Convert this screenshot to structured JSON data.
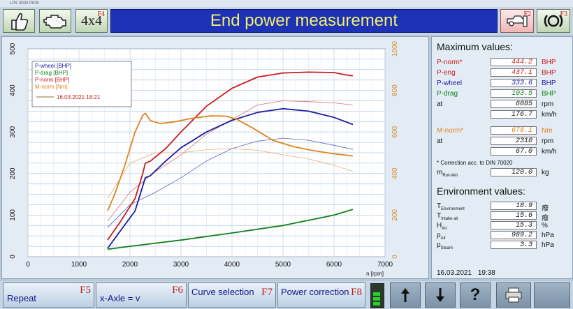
{
  "window": {
    "title": "LPS 3000 PKW"
  },
  "toolbar": {
    "f4_key": "F4",
    "four_by_four": "4x4",
    "f2_key": "F2",
    "f3_key": "F3",
    "icons": [
      "thumbs-up-icon",
      "engine-icon",
      "car-lift-icon",
      "brake-disc-icon"
    ]
  },
  "header": {
    "title": "End power measurement"
  },
  "legend": {
    "items": [
      "P-wheel [BHP]",
      "P-drag [BHP]",
      "P-norm [BHP]",
      "M-norm [Nm]"
    ],
    "run_date": "16.03.2021 18:21"
  },
  "colors": {
    "p_wheel": "#1c1ca6",
    "p_drag": "#10801a",
    "p_norm": "#c81c1c",
    "m_norm": "#e0821e",
    "accent": "#1d32b6"
  },
  "chart_data": {
    "type": "line",
    "xlabel": "n [rpm]",
    "xlim": [
      0,
      7000
    ],
    "ylim_left": [
      0,
      500
    ],
    "ylim_right": [
      0,
      1000
    ],
    "grid": true,
    "legend_position": "top-left",
    "x_ticks": [
      "0",
      "1000",
      "2000",
      "3000",
      "4000",
      "5000",
      "6000",
      "7000"
    ],
    "y_left_ticks": [
      "0",
      "100",
      "200",
      "300",
      "400",
      "500"
    ],
    "y_right_ticks": [
      "0",
      "200",
      "400",
      "600",
      "800",
      "1000"
    ],
    "series": [
      {
        "name": "P-wheel [BHP]",
        "axis": "left",
        "color": "#1c1ca6",
        "x": [
          1560,
          1800,
          2100,
          2250,
          2300,
          2400,
          2700,
          3000,
          3500,
          4000,
          4500,
          5000,
          5500,
          6000,
          6370
        ],
        "y": [
          20,
          60,
          110,
          170,
          190,
          195,
          230,
          262,
          300,
          328,
          347,
          356,
          350,
          335,
          318
        ]
      },
      {
        "name": "P-drag [BHP]",
        "axis": "left",
        "color": "#10801a",
        "x": [
          1560,
          2000,
          3000,
          4000,
          5000,
          6000,
          6370
        ],
        "y": [
          18,
          25,
          40,
          57,
          75,
          100,
          114
        ]
      },
      {
        "name": "P-norm [BHP]",
        "axis": "left",
        "color": "#c81c1c",
        "x": [
          1560,
          1800,
          2100,
          2250,
          2300,
          2400,
          2700,
          3000,
          3500,
          4000,
          4500,
          5000,
          5500,
          6000,
          6200,
          6370
        ],
        "y": [
          40,
          82,
          140,
          200,
          225,
          230,
          260,
          300,
          362,
          405,
          432,
          442,
          444,
          443,
          438,
          435
        ]
      },
      {
        "name": "M-norm [Nm]",
        "axis": "right",
        "color": "#e0821e",
        "x": [
          1560,
          1700,
          1900,
          2100,
          2250,
          2300,
          2400,
          2600,
          2900,
          3200,
          3600,
          3900,
          4100,
          4400,
          4800,
          5200,
          5600,
          6000,
          6370
        ],
        "y": [
          220,
          300,
          440,
          600,
          680,
          690,
          655,
          640,
          650,
          665,
          678,
          676,
          660,
          620,
          560,
          530,
          510,
          495,
          485
        ]
      }
    ],
    "comparison_run": {
      "label": "16.03.2021 18:21",
      "series": [
        {
          "name": "P-wheel",
          "axis": "left",
          "color": "#5a62c0",
          "x": [
            1560,
            2000,
            2500,
            3000,
            3500,
            4000,
            4500,
            5000,
            5500,
            6000,
            6370
          ],
          "y": [
            70,
            125,
            155,
            190,
            230,
            260,
            278,
            285,
            280,
            268,
            258
          ]
        },
        {
          "name": "P-norm",
          "axis": "left",
          "color": "#d87070",
          "x": [
            1560,
            2000,
            2500,
            3000,
            3500,
            4000,
            4500,
            5000,
            5500,
            6000,
            6370
          ],
          "y": [
            85,
            155,
            205,
            245,
            295,
            330,
            365,
            375,
            373,
            370,
            365
          ]
        },
        {
          "name": "M-norm",
          "axis": "right",
          "color": "#e0b070",
          "x": [
            1560,
            2000,
            2500,
            3000,
            3500,
            4000,
            4500,
            5000,
            5500,
            6000,
            6370
          ],
          "y": [
            280,
            450,
            500,
            500,
            515,
            520,
            512,
            490,
            470,
            440,
            410
          ]
        }
      ]
    }
  },
  "max_values": {
    "title": "Maximum values:",
    "rows": [
      {
        "label": "P-norm*",
        "value": "444.2",
        "unit": "BHP",
        "color": "#c81c1c"
      },
      {
        "label": "P-eng",
        "value": "437.1",
        "unit": "BHP",
        "color": "#c81c1c"
      },
      {
        "label": "P-wheel",
        "value": "333.6",
        "unit": "BHP",
        "color": "#1c1ca6"
      },
      {
        "label": "P-drag",
        "value": "103.5",
        "unit": "BHP",
        "color": "#10801a"
      },
      {
        "label": "at",
        "value": "6085",
        "unit": "rpm",
        "color": "#111111"
      },
      {
        "label": "",
        "value": "176.7",
        "unit": "km/h",
        "color": "#111111"
      },
      {
        "label": "M-norm*",
        "value": "678.1",
        "unit": "Nm",
        "color": "#e0821e"
      },
      {
        "label": "at",
        "value": "2310",
        "unit": "rpm",
        "color": "#111111"
      },
      {
        "label": "",
        "value": "67.0",
        "unit": "km/h",
        "color": "#111111"
      }
    ],
    "correction_note": "* Correction acc. to DIN 70020",
    "mass_label_main": "m",
    "mass_label_sub": "Rot-Veh",
    "mass_value": "120.0",
    "mass_unit": "kg"
  },
  "environment": {
    "title": "Environment values:",
    "rows": [
      {
        "label": "T",
        "sub": "Environment",
        "value": "18.9",
        "unit": "癈"
      },
      {
        "label": "T",
        "sub": "Intake air",
        "value": "15.6",
        "unit": "癈"
      },
      {
        "label": "H",
        "sub": "Air",
        "value": "15.3",
        "unit": "%"
      },
      {
        "label": "p",
        "sub": "Air",
        "value": "989.2",
        "unit": "hPa"
      },
      {
        "label": "p",
        "sub": "Steam",
        "value": "3.3",
        "unit": "hPa"
      }
    ],
    "date": "16.03.2021",
    "time": "19:38"
  },
  "bottom": {
    "repeat": "Repeat",
    "f5": "F5",
    "x_axle": "x-Axle = v",
    "f6": "F6",
    "curve_selection": "Curve selection",
    "f7": "F7",
    "power_correction": "Power correction",
    "f8": "F8",
    "help": "?"
  }
}
